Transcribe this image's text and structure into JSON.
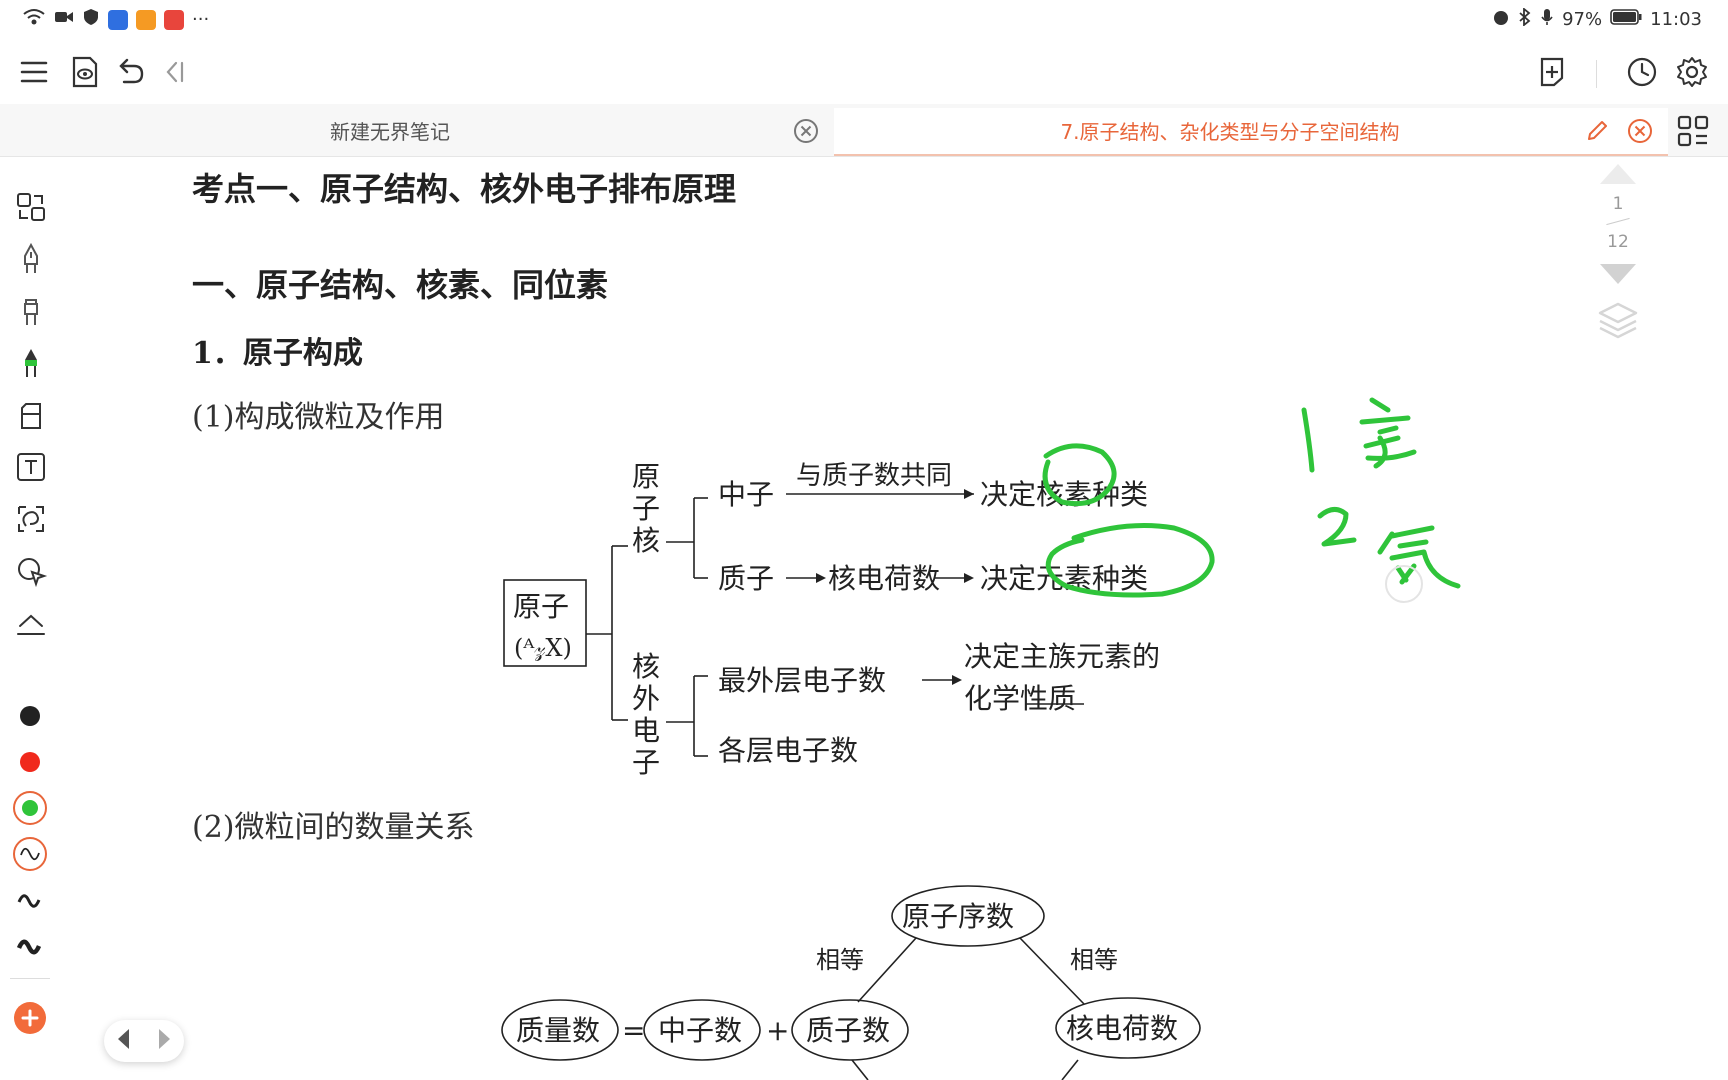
{
  "status": {
    "battery": "97%",
    "time": "11:03",
    "more": "···"
  },
  "tabs": [
    {
      "label": "新建无界笔记"
    },
    {
      "label": "7.原子结构、杂化类型与分子空间结构"
    }
  ],
  "pager": {
    "current": "1",
    "total": "12"
  },
  "doc": {
    "heading1": "考点一、原子结构、核外电子排布原理",
    "heading2": "一、原子结构、核素、同位素",
    "heading3": "1．原子构成",
    "sub1": "(1)构成微粒及作用",
    "sub2": "(2)微粒间的数量关系"
  },
  "diagram1": {
    "atom": "原子",
    "atom_symbol": "(ᴬ𝓏X)",
    "nucleus": [
      "原",
      "子",
      "核"
    ],
    "electrons": [
      "核",
      "外",
      "电",
      "子"
    ],
    "neutron": "中子",
    "neutron_note": "与质子数共同",
    "neutron_result": "决定核素种类",
    "proton": "质子",
    "nuclear_charge": "核电荷数",
    "proton_result": "决定元素种类",
    "outer_electrons": "最外层电子数",
    "outer_result_1": "决定主族元素的",
    "outer_result_2": "化学性质",
    "layer_electrons": "各层电子数"
  },
  "diagram2": {
    "atomic_number": "原子序数",
    "equal_left": "相等",
    "equal_right": "相等",
    "mass_number": "质量数",
    "eq": "=",
    "neutron_count": "中子数",
    "plus": "+",
    "proton_count": "质子数",
    "nuclear_charge": "核电荷数"
  },
  "handwriting": {
    "line1": "1 氢",
    "line2": "2 氘"
  },
  "colors": {
    "accent": "#e8663a",
    "ink_green": "#2fc43a",
    "pen_red": "#f0291c",
    "pen_black": "#222222",
    "add_button": "#f26b3a"
  }
}
